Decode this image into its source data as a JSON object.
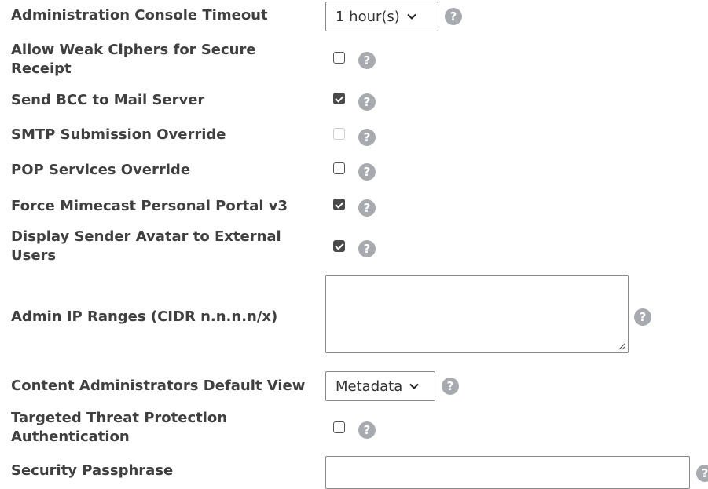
{
  "settings": {
    "console_timeout": {
      "label": "Administration Console Timeout",
      "value": "1 hour(s)"
    },
    "weak_ciphers": {
      "label": "Allow Weak Ciphers for Secure Receipt",
      "checked": false
    },
    "send_bcc": {
      "label": "Send BCC to Mail Server",
      "checked": true
    },
    "smtp_override": {
      "label": "SMTP Submission Override",
      "checked": false,
      "disabled": true
    },
    "pop_override": {
      "label": "POP Services Override",
      "checked": false
    },
    "force_portal": {
      "label": "Force Mimecast Personal Portal v3",
      "checked": true
    },
    "sender_avatar": {
      "label": "Display Sender Avatar to External Users",
      "checked": true
    },
    "admin_ip": {
      "label": "Admin IP Ranges (CIDR n.n.n.n/x)",
      "value": ""
    },
    "content_view": {
      "label": "Content Administrators Default View",
      "value": "Metadata"
    },
    "ttp_auth": {
      "label": "Targeted Threat Protection Authentication",
      "checked": false
    },
    "passphrase": {
      "label": "Security Passphrase",
      "value": ""
    }
  },
  "help_glyph": "?",
  "icons": {
    "help": "help-icon",
    "dropdown": "chevron-down-icon",
    "resize": "resize-grip-icon"
  }
}
